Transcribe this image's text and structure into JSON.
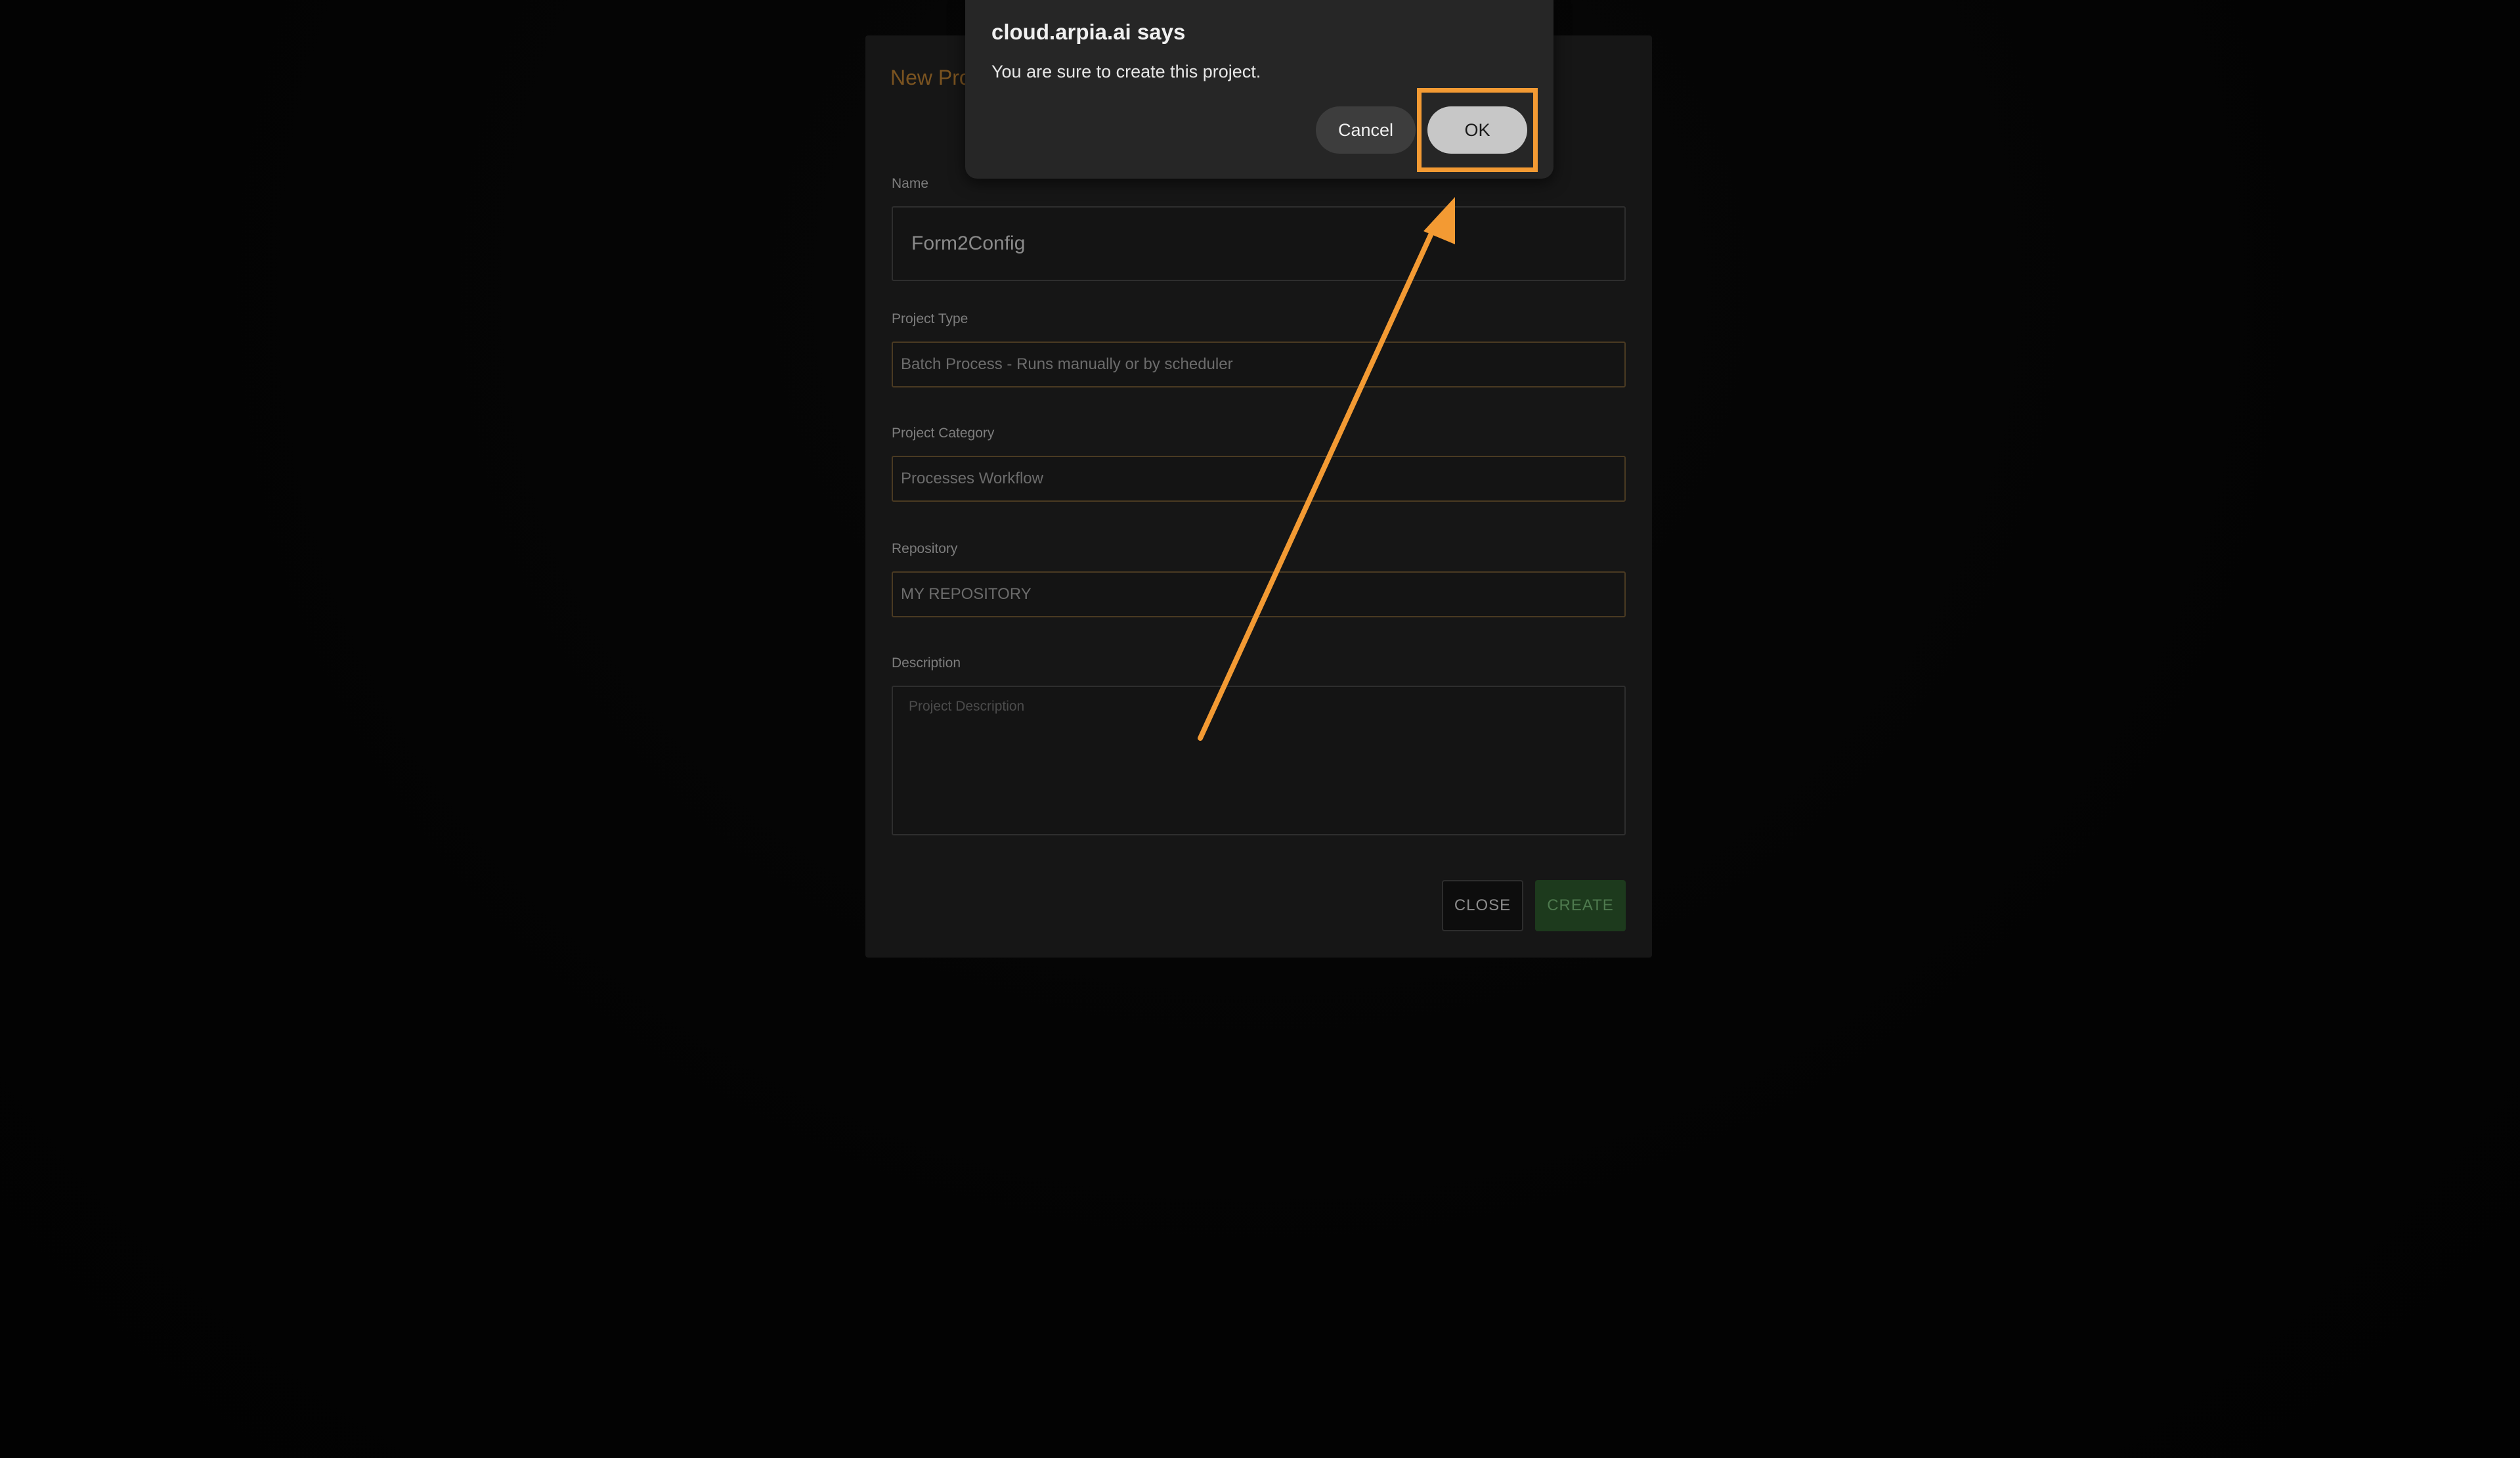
{
  "modal": {
    "title": "New Pro",
    "fields": {
      "name": {
        "label": "Name",
        "value": "Form2Config"
      },
      "project_type": {
        "label": "Project Type",
        "value": "Batch Process - Runs manually or by scheduler"
      },
      "project_category": {
        "label": "Project Category",
        "value": "Processes Workflow"
      },
      "repository": {
        "label": "Repository",
        "value": "MY REPOSITORY"
      },
      "description": {
        "label": "Description",
        "placeholder": "Project Description"
      }
    },
    "buttons": {
      "close": "CLOSE",
      "create": "CREATE"
    }
  },
  "alert": {
    "title": "cloud.arpia.ai says",
    "message": "You are sure to create this project.",
    "cancel_label": "Cancel",
    "ok_label": "OK"
  },
  "annotation": {
    "highlight_color": "#f39a33",
    "arrow_color": "#f39a33"
  }
}
